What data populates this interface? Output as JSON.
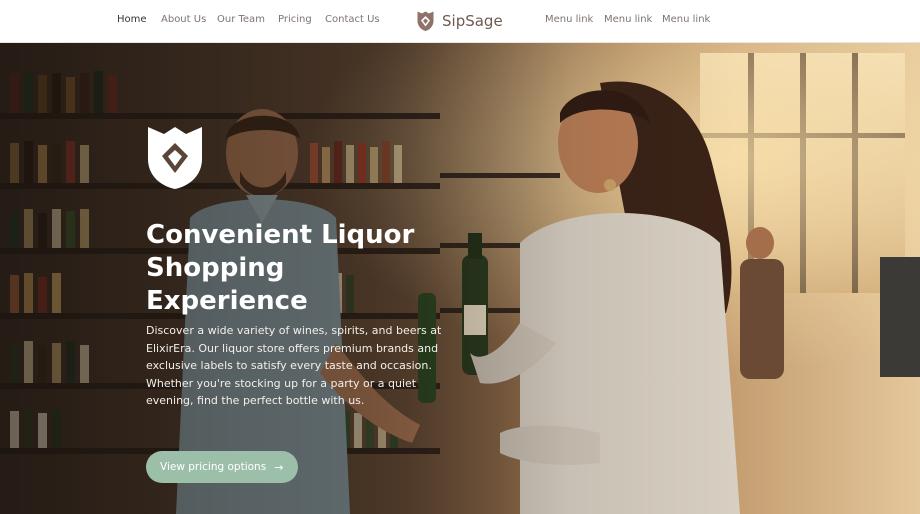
{
  "nav": {
    "left_links": [
      {
        "label": "Home",
        "active": true
      },
      {
        "label": "About Us"
      },
      {
        "label": "Our Team"
      },
      {
        "label": "Pricing"
      },
      {
        "label": "Contact Us"
      }
    ],
    "brand": "SipSage",
    "right_links": [
      {
        "label": "Menu link"
      },
      {
        "label": "Menu link"
      },
      {
        "label": "Menu link"
      }
    ]
  },
  "hero": {
    "title": "Convenient Liquor Shopping Experience",
    "description": "Discover a wide variety of wines, spirits, and beers at ElixirEra. Our liquor store offers premium brands and exclusive labels to satisfy every taste and occasion. Whether you're stocking up for a party or a quiet evening, find the perfect bottle with us.",
    "cta_label": "View pricing options",
    "cta_icon": "arrow-right-icon"
  },
  "colors": {
    "brand": "#6d5b53",
    "cta": "#9bbfa8",
    "nav_text": "#7d7470"
  }
}
